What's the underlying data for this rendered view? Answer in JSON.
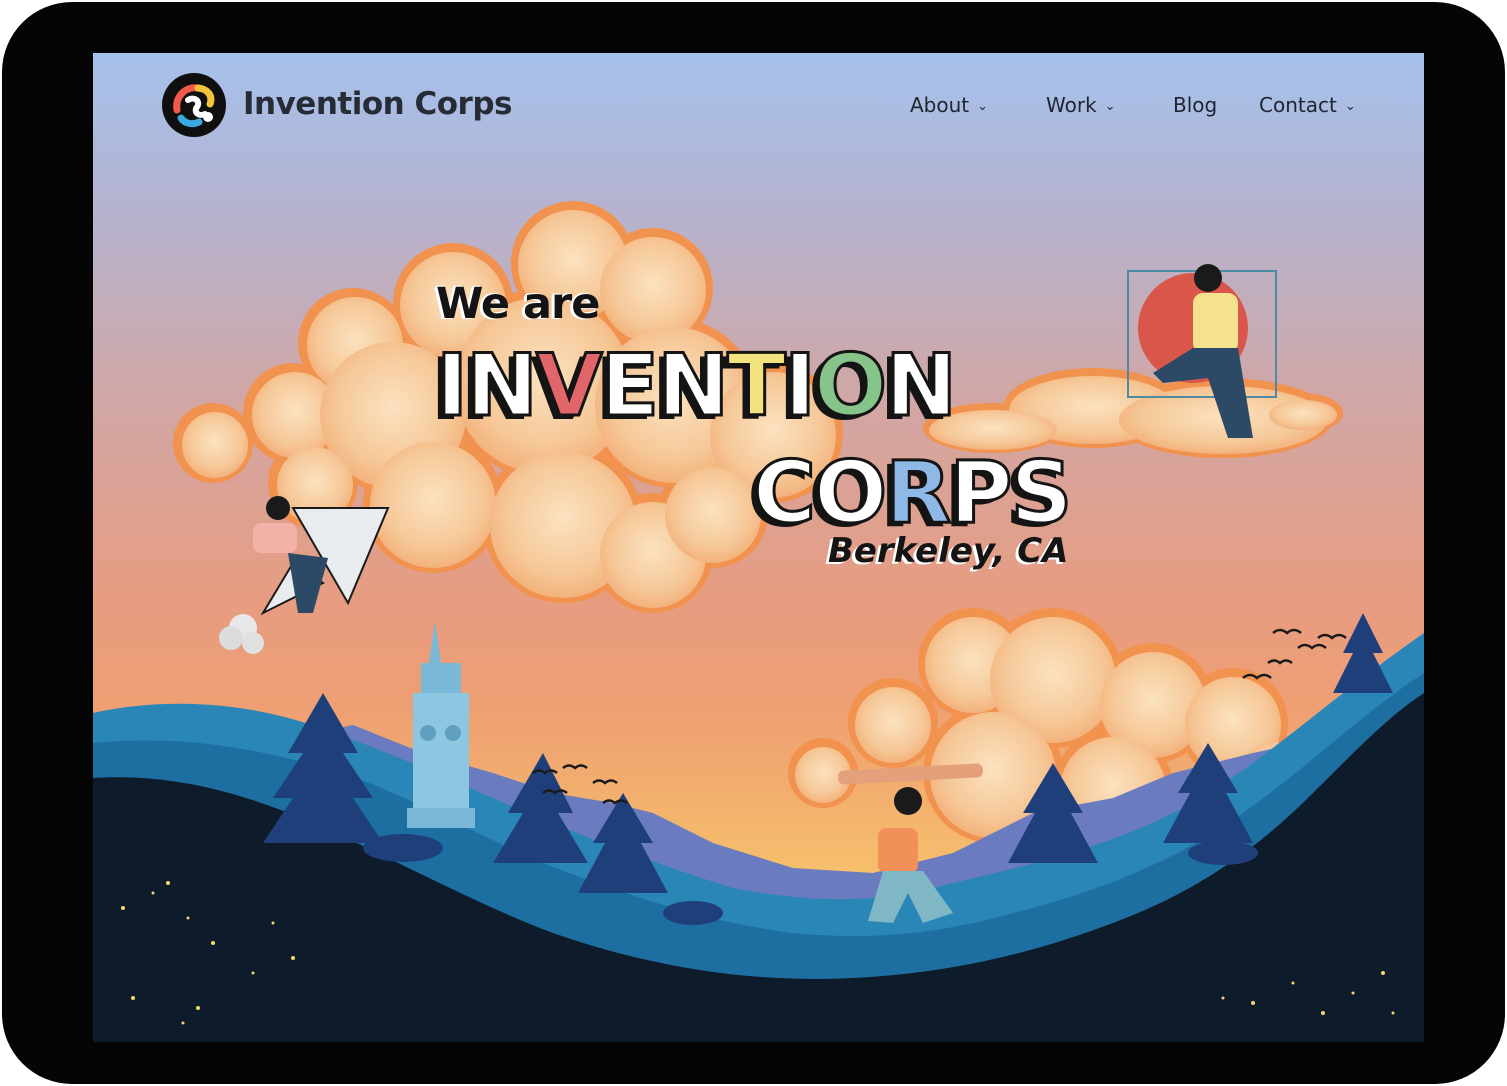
{
  "brand": {
    "name": "Invention Corps"
  },
  "nav": {
    "items": [
      {
        "label": "About",
        "has_dropdown": true
      },
      {
        "label": "Work",
        "has_dropdown": true
      },
      {
        "label": "Blog",
        "has_dropdown": false
      },
      {
        "label": "Contact",
        "has_dropdown": true
      }
    ]
  },
  "hero": {
    "line1": "We are",
    "inv_a": "IN",
    "inv_b": "V",
    "inv_c": "EN",
    "inv_d": "T",
    "inv_e": "I",
    "inv_f": "O",
    "inv_g": "N",
    "corps_a": "CO",
    "corps_b": "R",
    "corps_c": "PS",
    "location": "Berkeley, CA"
  },
  "icons": {
    "logo": "invention-corps-logo-icon",
    "dropdown": "chevron-down-icon"
  },
  "colors": {
    "sky_top": "#a6c1ec",
    "sky_bottom": "#f5c46e",
    "cloud": "#f8d2a4",
    "cloud_edge": "#f2925a",
    "hill_dark": "#0d1b2a",
    "hill_blue": "#1c6fa0",
    "tree": "#1f3f7a",
    "text_dark": "#1f2530"
  }
}
